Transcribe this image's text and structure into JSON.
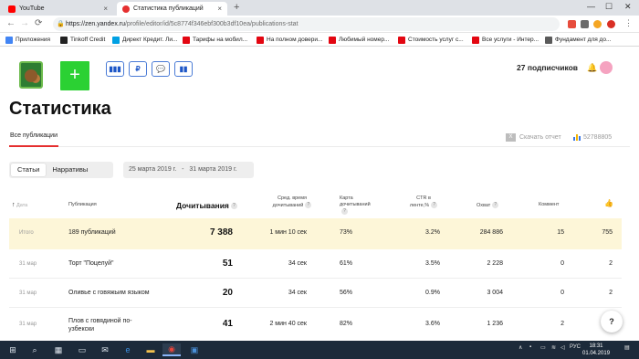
{
  "browser": {
    "tabs": [
      {
        "title": "YouTube",
        "icon_color": "#ff0000",
        "close": "×"
      },
      {
        "title": "Статистика публикаций",
        "icon_color": "#e52f2f",
        "close": "×"
      }
    ],
    "new_tab": "+",
    "url_host": "https://zen.yandex.ru",
    "url_path": "/profile/editor/id/5c8774f346ebf300b3df10ea/publications-stat",
    "bookmarks": [
      {
        "label": "Приложения",
        "color": "#4285f4"
      },
      {
        "label": "Tinkoff Credit",
        "color": "#222222"
      },
      {
        "label": "Директ Кредит. Ли...",
        "color": "#00a0e3"
      },
      {
        "label": "Тарифы на мобил...",
        "color": "#e30611"
      },
      {
        "label": "На полном довери...",
        "color": "#e30611"
      },
      {
        "label": "Любимый номер...",
        "color": "#e30611"
      },
      {
        "label": "Стоимость услуг с...",
        "color": "#e30611"
      },
      {
        "label": "Все услуги - Интер...",
        "color": "#e30611"
      },
      {
        "label": "Фундамент для до...",
        "color": "#5a5a5a"
      }
    ]
  },
  "header": {
    "add_label": "+",
    "tool_icons": [
      "▮▮▮",
      "₽",
      "💬",
      "▮▮"
    ],
    "subscribers": "27 подписчиков",
    "bell": "🔔"
  },
  "page": {
    "title": "Статистика",
    "tab_all": "Все публикации",
    "download": "Скачать отчет",
    "views_total": "52788805",
    "segments": [
      "Статьи",
      "Нарративы"
    ],
    "date_from": "25 марта 2019 г.",
    "date_sep": "-",
    "date_to": "31 марта 2019 г."
  },
  "table": {
    "headers": {
      "date": "Дата",
      "publication": "Публикация",
      "reads": "Дочитывания",
      "avg_time": "Сред. время дочитываний",
      "card": "Карта дочитываний",
      "ctr": "CTR в ленте,%",
      "reach": "Охват",
      "comments": "Коммент",
      "likes": "👍"
    },
    "total": {
      "label": "Итого",
      "publication": "189 публикаций",
      "reads": "7 388",
      "avg_time": "1 мин 10 сек",
      "card": "73%",
      "ctr": "3.2%",
      "reach": "284 886",
      "comments": "15",
      "likes": "755"
    },
    "rows": [
      {
        "date": "31 мар",
        "publication": "Торт \"Поцелуй\"",
        "reads": "51",
        "avg_time": "34 сек",
        "card": "61%",
        "ctr": "3.5%",
        "reach": "2 228",
        "comments": "0",
        "likes": "2"
      },
      {
        "date": "31 мар",
        "publication": "Оливье с говяжьим языком",
        "reads": "20",
        "avg_time": "34 сек",
        "card": "56%",
        "ctr": "0.9%",
        "reach": "3 004",
        "comments": "0",
        "likes": "2"
      },
      {
        "date": "31 мар",
        "publication": "Плов с говядиной по-узбекски",
        "reads": "41",
        "avg_time": "2 мин 40 сек",
        "card": "82%",
        "ctr": "3.6%",
        "reach": "1 236",
        "comments": "2",
        "likes": ""
      }
    ]
  },
  "help": "?",
  "taskbar": {
    "lang": "РУС",
    "time": "18:31",
    "date": "01.04.2019"
  }
}
